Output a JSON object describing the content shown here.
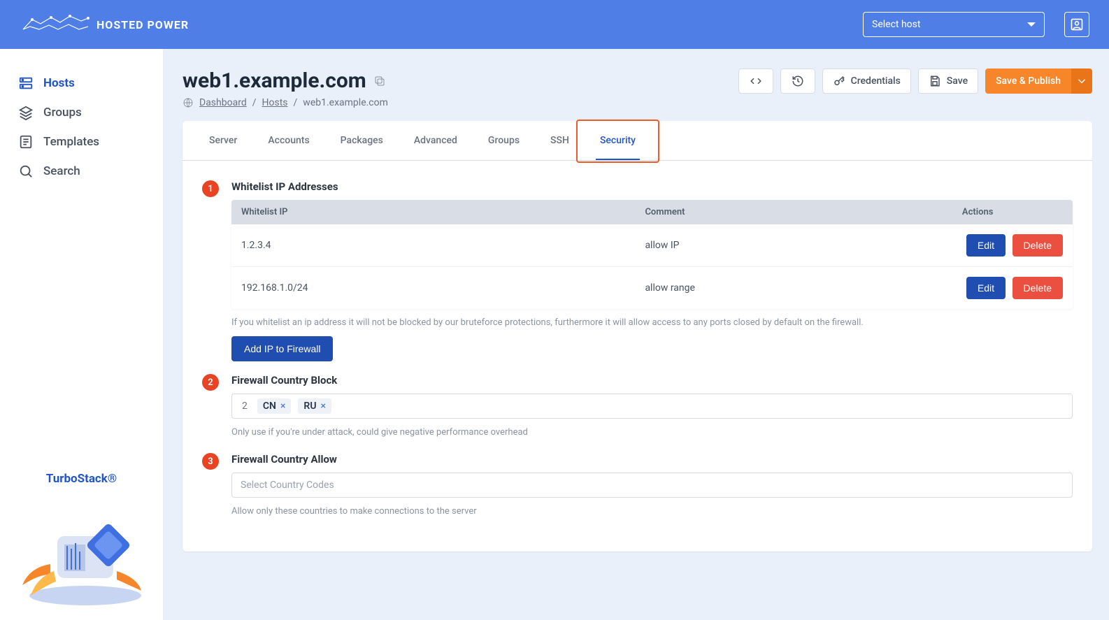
{
  "brand": "HOSTED POWER",
  "host_selector_placeholder": "Select host",
  "sidebar": {
    "items": [
      {
        "label": "Hosts",
        "active": true
      },
      {
        "label": "Groups",
        "active": false
      },
      {
        "label": "Templates",
        "active": false
      },
      {
        "label": "Search",
        "active": false
      }
    ],
    "footer_brand": "TurboStack®"
  },
  "page": {
    "title": "web1.example.com",
    "breadcrumb": {
      "dashboard": "Dashboard",
      "hosts": "Hosts",
      "current": "web1.example.com"
    }
  },
  "head_actions": {
    "credentials": "Credentials",
    "save": "Save",
    "save_publish": "Save & Publish"
  },
  "tabs": [
    {
      "label": "Server"
    },
    {
      "label": "Accounts"
    },
    {
      "label": "Packages"
    },
    {
      "label": "Advanced"
    },
    {
      "label": "Groups"
    },
    {
      "label": "SSH"
    },
    {
      "label": "Security",
      "active": true
    }
  ],
  "sections": {
    "whitelist": {
      "num": "1",
      "title": "Whitelist IP Addresses",
      "columns": {
        "ip": "Whitelist IP",
        "comment": "Comment",
        "actions": "Actions"
      },
      "rows": [
        {
          "ip": "1.2.3.4",
          "comment": "allow IP"
        },
        {
          "ip": "192.168.1.0/24",
          "comment": "allow range"
        }
      ],
      "edit_label": "Edit",
      "delete_label": "Delete",
      "hint": "If you whitelist an ip address it will not be blocked by our bruteforce protections, furthermore it will allow access to any ports closed by default on the firewall.",
      "add_btn": "Add IP to Firewall"
    },
    "country_block": {
      "num": "2",
      "title": "Firewall Country Block",
      "count": "2",
      "chips": [
        "CN",
        "RU"
      ],
      "hint": "Only use if you're under attack, could give negative performance overhead"
    },
    "country_allow": {
      "num": "3",
      "title": "Firewall Country Allow",
      "placeholder": "Select Country Codes",
      "hint": "Allow only these countries to make connections to the server"
    }
  }
}
